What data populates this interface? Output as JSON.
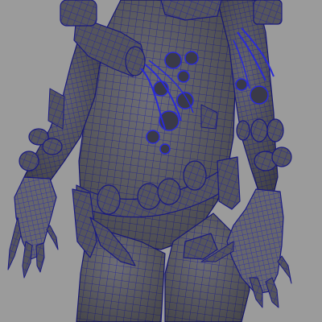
{
  "viewport": {
    "background_color": "#9b9b9b",
    "mesh_fill_color": "#6e6e74",
    "mesh_shadow_color": "#4a4a52",
    "wire_color": "#1f1fa0",
    "wire_highlight_color": "#2a2ad8",
    "subject": "wireframe-mesh-character-torso"
  }
}
